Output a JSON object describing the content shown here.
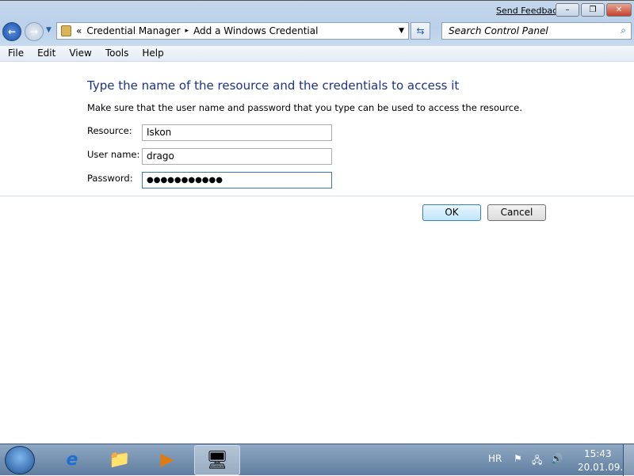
{
  "window": {
    "send_feedback": "Send Feedback",
    "minimize": "–",
    "restore": "❐",
    "close": "✕"
  },
  "nav": {
    "back": "←",
    "forward": "→",
    "history": "▼"
  },
  "address": {
    "chevron": "«",
    "crumbs": [
      "Credential Manager",
      "Add a Windows Credential"
    ],
    "sep": "▸",
    "dropdown": "▼",
    "refresh": "⇆"
  },
  "search": {
    "placeholder": "Search Control Panel",
    "icon": "⌕"
  },
  "menu": [
    "File",
    "Edit",
    "View",
    "Tools",
    "Help"
  ],
  "form": {
    "title": "Type the name of the resource and the credentials to access it",
    "description": "Make sure that the user name and password that you type can be used to access the resource.",
    "resource_label": "Resource:",
    "resource_value": "Iskon",
    "username_label": "User name:",
    "username_value": "drago",
    "password_label": "Password:",
    "password_value": "●●●●●●●●●●●"
  },
  "buttons": {
    "ok": "OK",
    "cancel": "Cancel"
  },
  "taskbar": {
    "items": [
      "e",
      "📁",
      "▶",
      "🖥"
    ],
    "language": "HR",
    "time": "15:43",
    "date": "20.01.09.",
    "tray_icons": [
      "⚑",
      "🖧",
      "🔊"
    ]
  }
}
